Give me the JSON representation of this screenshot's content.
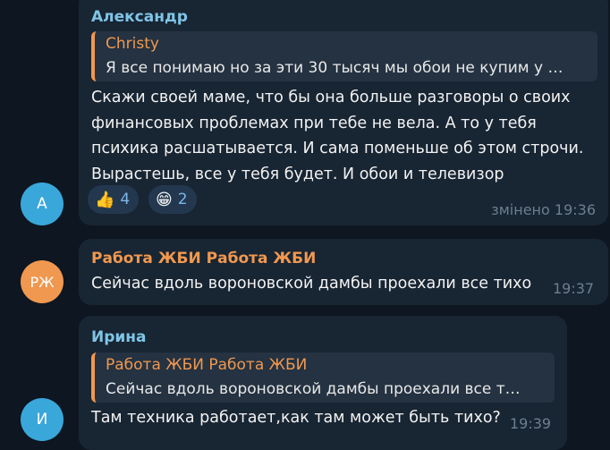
{
  "messages": [
    {
      "sender": "Александр",
      "sender_color": "#7fc4e6",
      "avatar_initials": "А",
      "avatar_color": "#3aa7db",
      "reply": {
        "name": "Christy",
        "text": "Я все понимаю но за эти 30 тысяч мы обои не купим у …",
        "color": "#f0984f"
      },
      "text": "Скажи своей маме, что бы она больше разговоры о своих\nфинансовых проблемах при тебе не вела. А то у тебя\nпсихика расшатывается. И сама поменьше об этом строчи.\nВырастешь, все у тебя будет. И обои и телевизор",
      "reactions": [
        {
          "emoji": "👍",
          "icon": "thumbs-up-icon",
          "count": "4"
        },
        {
          "emoji": "😁",
          "icon": "grinning-face-icon",
          "count": "2"
        }
      ],
      "meta": "змінено 19:36"
    },
    {
      "sender": "Работа ЖБИ Работа ЖБИ",
      "sender_color": "#f0984f",
      "avatar_initials": "РЖ",
      "avatar_color": "#f0984f",
      "text": "Сейчас вдоль вороновской дамбы проехали все тихо",
      "meta": "19:37"
    },
    {
      "sender": "Ирина",
      "sender_color": "#7fc4e6",
      "avatar_initials": "И",
      "avatar_color": "#3aa7db",
      "reply": {
        "name": "Работа ЖБИ Работа ЖБИ",
        "text": "Сейчас вдоль вороновской дамбы проехали все т…",
        "color": "#f0984f"
      },
      "text": "Там техника работает,как там может быть тихо?",
      "meta": "19:39"
    }
  ]
}
